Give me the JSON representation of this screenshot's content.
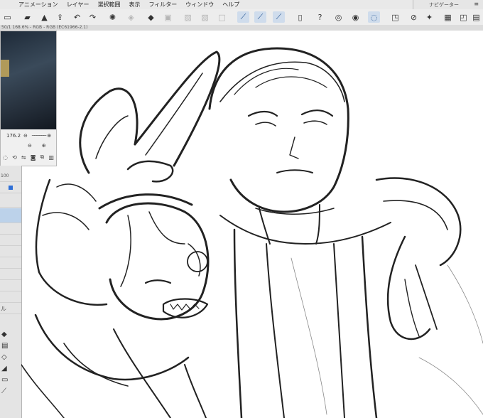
{
  "menu": {
    "items": [
      "アニメーション",
      "レイヤー",
      "選択範囲",
      "表示",
      "フィルター",
      "ウィンドウ",
      "ヘルプ"
    ]
  },
  "navigator": {
    "title": "ナビゲーター",
    "zoom": "176.2",
    "zoom_small": "100"
  },
  "document_tab": {
    "label": "50/1 168.6% - RGB - RGB (EC61966-2.1)"
  },
  "side_tools": {
    "label": "ル"
  },
  "colors": {
    "accent": "#cfdcec",
    "layer_selected": "#bcd2ea"
  },
  "toolbar_icons": [
    "new-file-icon",
    "open-folder-icon",
    "save-icon",
    "upload-icon",
    "undo-icon",
    "redo-icon",
    "clear-icon",
    "fill-icon",
    "transform-icon",
    "select-all-icon",
    "deselect-icon",
    "invert-selection-icon",
    "pen-icon",
    "pencil-icon",
    "brush-icon",
    "tablet-icon",
    "help-icon",
    "vector-icon",
    "blend-icon",
    "lasso-icon",
    "crop-icon",
    "ruler-icon",
    "wand-icon",
    "grid-icon",
    "window-icon",
    "settings-icon"
  ]
}
